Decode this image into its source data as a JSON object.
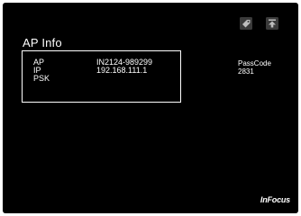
{
  "header": {
    "title": "AP Info",
    "icons": {
      "tag": "tag-icon",
      "top": "move-to-top-icon"
    }
  },
  "info": {
    "rows": [
      {
        "label": "AP",
        "value": "IN2124-989299"
      },
      {
        "label": "IP",
        "value": "192.168.111.1"
      },
      {
        "label": "PSK",
        "value": ""
      }
    ]
  },
  "passcode": {
    "label": "PassCode",
    "value": "2831"
  },
  "brand": "InFocus",
  "colors": {
    "background": "#000000",
    "text": "#ffffff",
    "icon": "#9a9a9a"
  }
}
